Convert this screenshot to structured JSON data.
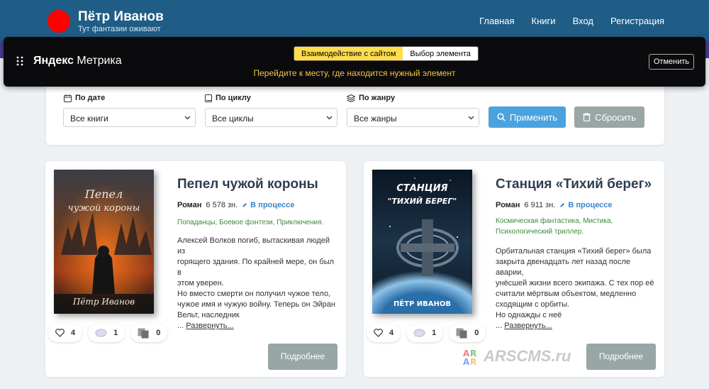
{
  "header": {
    "title": "Пётр Иванов",
    "tagline": "Тут фантазии оживают",
    "nav": [
      "Главная",
      "Книги",
      "Вход",
      "Регистрация"
    ],
    "brand_color": "#ff0000",
    "bg_color": "#1f5d86"
  },
  "metrika": {
    "logo_bold": "Яндекс",
    "logo_rest": " Метрика",
    "mode_active": "Взаимодействие с сайтом",
    "mode_inactive": "Выбор элемента",
    "hint": "Перейдите к месту, где находится нужный элемент",
    "cancel": "Отменить"
  },
  "filters": {
    "date_label": "По дате",
    "date_value": "Все книги",
    "cycle_label": "По циклу",
    "cycle_value": "Все циклы",
    "genre_label": "По жанру",
    "genre_value": "Все жанры",
    "apply": "Применить",
    "reset": "Сбросить"
  },
  "books": [
    {
      "title": "Пепел чужой короны",
      "type": "Роман",
      "chars": "6 578 зн.",
      "status": "В процессе",
      "genres": "Попаданцы, Боевое фэнтези, Приключения.",
      "annotation_lines": [
        "Алексей Волков погиб, вытаскивая людей из",
        "горящего здания. По крайней мере, он был в",
        "этом уверен.",
        "Но вместо смерти он получил чужое тело,",
        "чужое имя и чужую войну. Теперь он Эйран",
        "Вельт, наследник"
      ],
      "expand": "Развернуть...",
      "cover_title_1": "Пепел",
      "cover_title_2": "чужой короны",
      "cover_author": "Пётр Иванов",
      "likes": "4",
      "comments": "1",
      "pages": "0",
      "more": "Подробнее"
    },
    {
      "title": "Станция «Тихий берег»",
      "type": "Роман",
      "chars": "6 911 зн.",
      "status": "В процессе",
      "genres_lines": [
        "Космическая фантастика, Мистика,",
        "Психологический триллер."
      ],
      "annotation_lines": [
        "Орбитальная станция «Тихий берег» была",
        "закрыта двенадцать лет назад после аварии,",
        "унёсшей жизни всего экипажа. С тех пор её",
        "считали мёртвым объектом, медленно",
        "сходящим с орбиты.",
        "Но однажды с неё"
      ],
      "expand": "Развернуть...",
      "cover_title_1": "СТАНЦИЯ",
      "cover_title_2": "\"ТИХИЙ БЕРЕГ\"",
      "cover_author": "ПЁТР ИВАНОВ",
      "likes": "4",
      "comments": "1",
      "pages": "0",
      "more": "Подробнее"
    }
  ],
  "watermark": "ARSCMS.ru"
}
